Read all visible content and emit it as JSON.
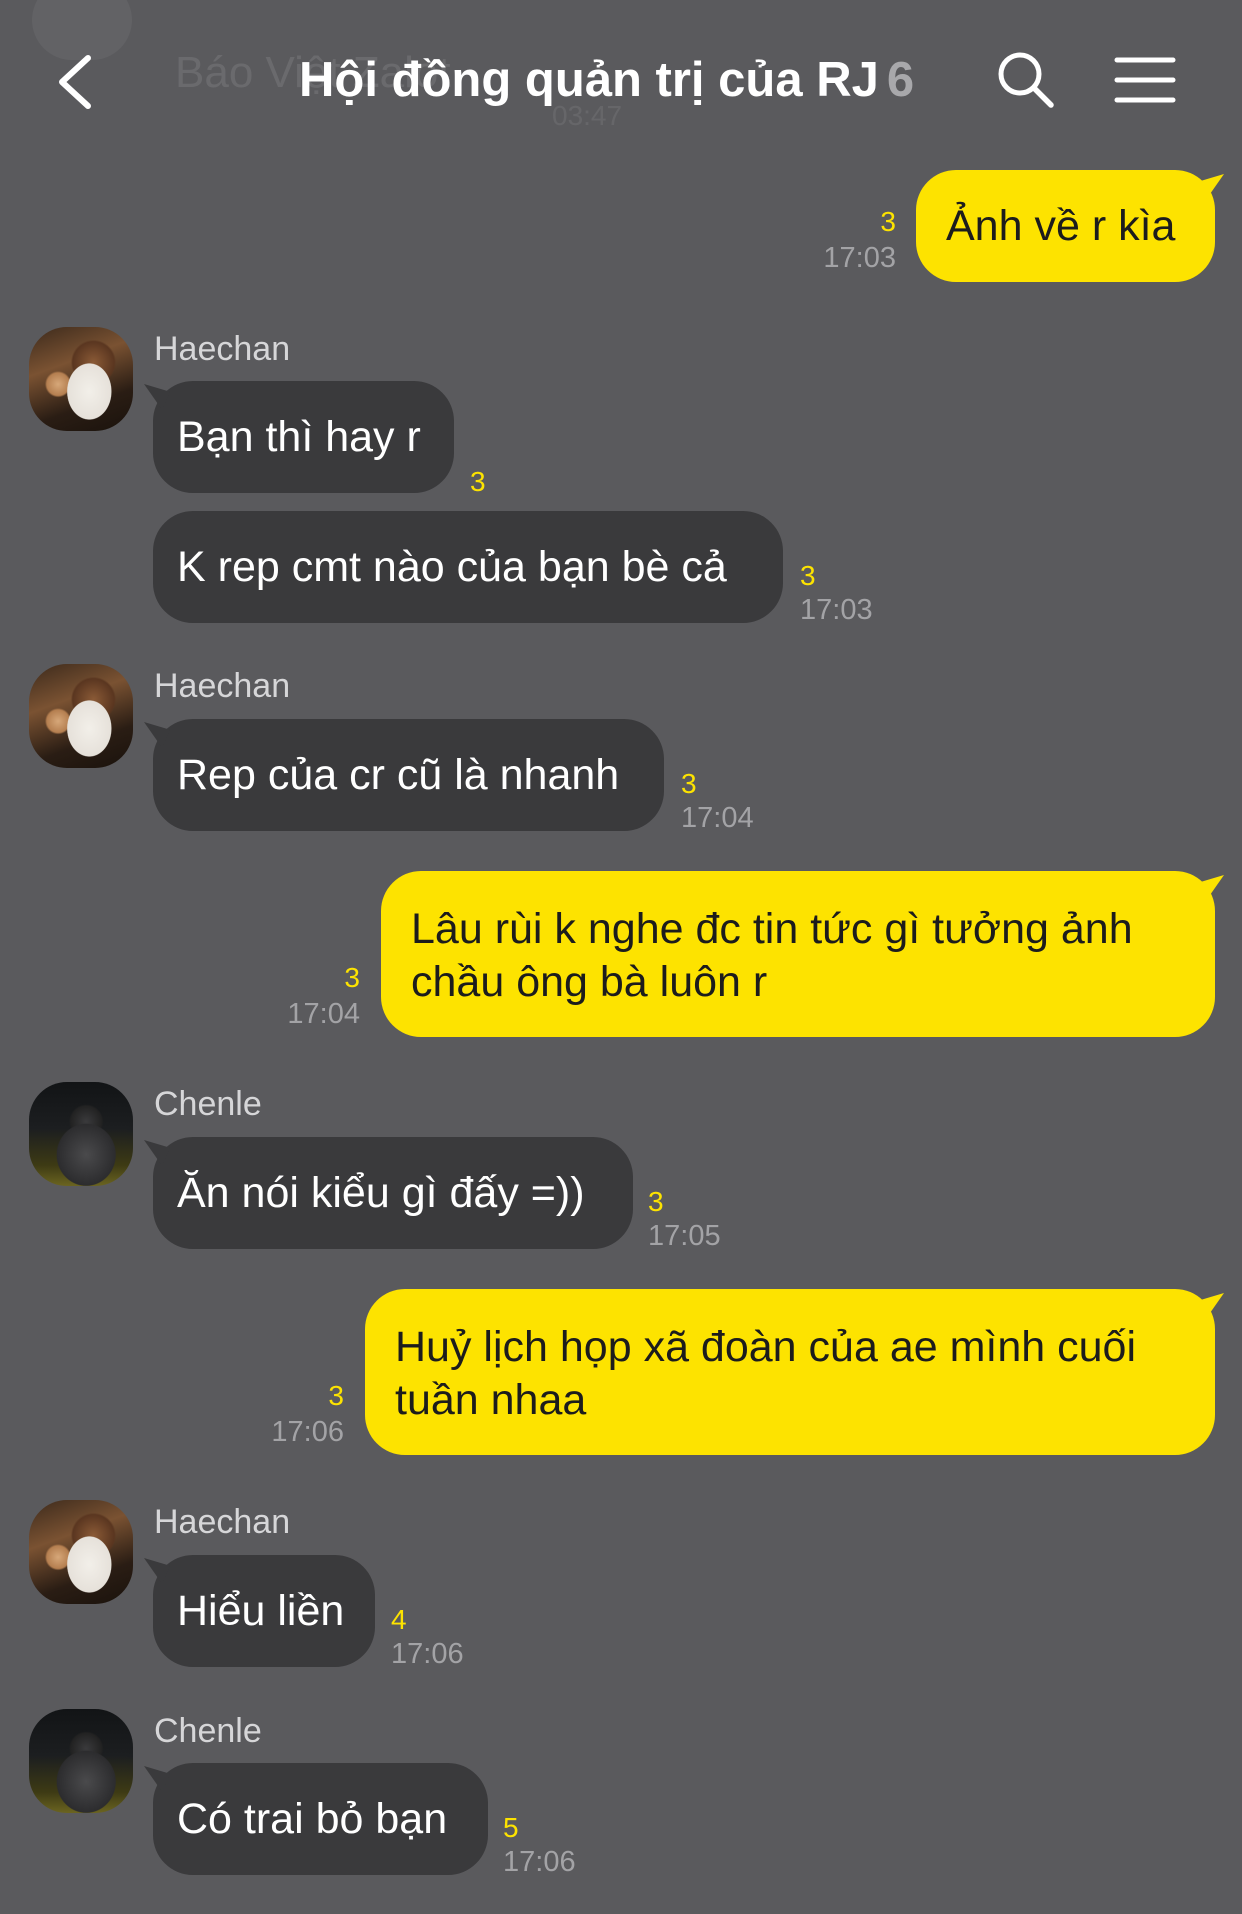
{
  "header": {
    "title": "Hội đồng quản trị của RJ",
    "member_count": "6",
    "ghost_text": "Báo Việt Zalot",
    "ghost_time": "03:47"
  },
  "messages": [
    {
      "direction": "out",
      "text": "Ảnh về r kìa",
      "unread": "3",
      "time": "17:03"
    },
    {
      "direction": "in",
      "sender": "Haechan",
      "text": "Bạn thì hay r",
      "unread": "3",
      "time": ""
    },
    {
      "direction": "in",
      "sender": "",
      "text": "K rep cmt nào của bạn bè cả",
      "unread": "3",
      "time": "17:03"
    },
    {
      "direction": "in",
      "sender": "Haechan",
      "text": "Rep của cr cũ là nhanh",
      "unread": "3",
      "time": "17:04"
    },
    {
      "direction": "out",
      "text": "Lâu rùi k nghe đc tin tức gì tưởng ảnh chầu ông bà luôn r",
      "unread": "3",
      "time": "17:04"
    },
    {
      "direction": "in",
      "sender": "Chenle",
      "text": "Ăn nói kiểu gì đấy =))",
      "unread": "3",
      "time": "17:05"
    },
    {
      "direction": "out",
      "text": "Huỷ lịch họp xã đoàn của ae mình cuối tuần nhaa",
      "unread": "3",
      "time": "17:06"
    },
    {
      "direction": "in",
      "sender": "Haechan",
      "text": "Hiểu liền",
      "unread": "4",
      "time": "17:06"
    },
    {
      "direction": "in",
      "sender": "Chenle",
      "text": "Có trai bỏ bạn",
      "unread": "5",
      "time": "17:06"
    }
  ],
  "colors": {
    "background": "#5a5a5d",
    "incoming_bubble": "#3a3a3c",
    "outgoing_bubble": "#fde300",
    "unread_count": "#fde300"
  },
  "icons": {
    "back": "chevron-left-icon",
    "search": "search-icon",
    "menu": "hamburger-menu-icon"
  }
}
